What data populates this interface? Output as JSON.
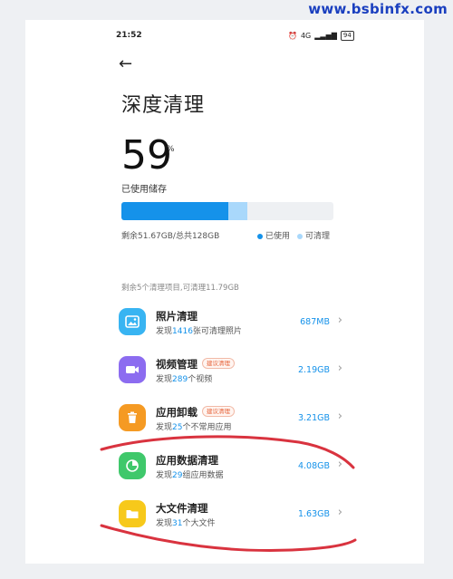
{
  "watermark": "www.bsbinfx.com",
  "status_bar": {
    "time": "21:52",
    "signal": "4G",
    "battery": "94"
  },
  "page": {
    "back_icon": "arrow-left-icon",
    "title": "深度清理"
  },
  "storage": {
    "percent": "59",
    "percent_sign": "%",
    "label": "已使用储存",
    "used_fraction": 0.505,
    "cleanable_fraction": 0.09,
    "summary": "剩余51.67GB/总共128GB",
    "legend_used": "已使用",
    "legend_cleanable": "可清理",
    "color_used": "#1592ea",
    "color_cleanable": "#a9d8fb"
  },
  "section_header": "剩余5个清理项目,可清理11.79GB",
  "items": [
    {
      "name": "照片清理",
      "desc_prefix": "发现",
      "desc_num": "1416",
      "desc_suffix": "张可清理照片",
      "size": "687MB",
      "icon": "photo-icon",
      "icon_color": "#38b4f2",
      "tag": ""
    },
    {
      "name": "视频管理",
      "desc_prefix": "发现",
      "desc_num": "289",
      "desc_suffix": "个视频",
      "size": "2.19GB",
      "icon": "video-icon",
      "icon_color": "#8c6cf0",
      "tag": "建议清理"
    },
    {
      "name": "应用卸载",
      "desc_prefix": "发现",
      "desc_num": "25",
      "desc_suffix": "个不常用应用",
      "size": "3.21GB",
      "icon": "trash-icon",
      "icon_color": "#f59a23",
      "tag": "建议清理"
    },
    {
      "name": "应用数据清理",
      "desc_prefix": "发现",
      "desc_num": "29",
      "desc_suffix": "组应用数据",
      "size": "4.08GB",
      "icon": "pie-chart-icon",
      "icon_color": "#3fc86b",
      "tag": ""
    },
    {
      "name": "大文件清理",
      "desc_prefix": "发现",
      "desc_num": "31",
      "desc_suffix": "个大文件",
      "size": "1.63GB",
      "icon": "folder-icon",
      "icon_color": "#f7c91b",
      "tag": ""
    }
  ],
  "chevron": "›",
  "annotation_color": "#d9333f"
}
